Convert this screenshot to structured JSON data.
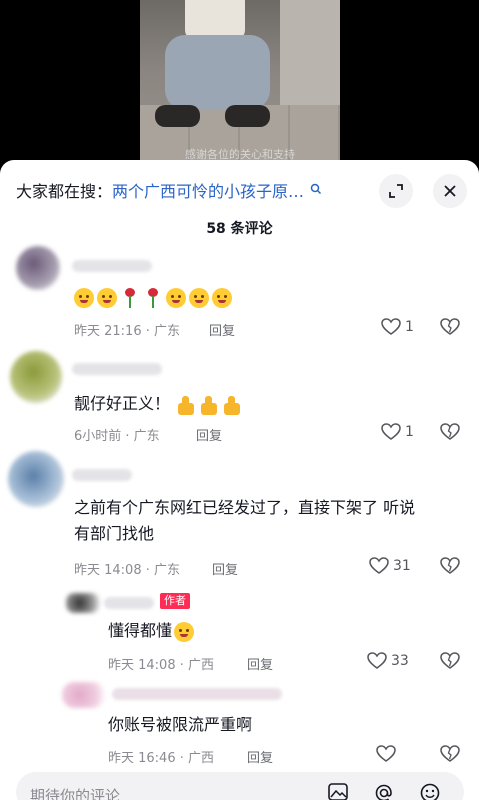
{
  "video": {
    "caption": "感谢各位的关心和支持"
  },
  "header": {
    "search_prefix": "大家都在搜：",
    "search_term": "两个广西可怜的小孩子原…"
  },
  "comment_count": "58 条评论",
  "comments": [
    {
      "text": "",
      "time": "昨天 21:16 · 广东",
      "reply": "回复",
      "likes": "1"
    },
    {
      "text": "靓仔好正义！",
      "time": "6小时前 · 广东",
      "reply": "回复",
      "likes": "1"
    },
    {
      "text_line1": "之前有个广东网红已经发过了，直接下架了 听说",
      "text_line2": "有部门找他",
      "time": "昨天 14:08 · 广东",
      "reply": "回复",
      "likes": "31"
    },
    {
      "badge": "作者",
      "text": "懂得都懂",
      "time": "昨天 14:08 · 广西",
      "reply": "回复",
      "likes": "33"
    },
    {
      "text": "你账号被限流严重啊",
      "time": "昨天 16:46 · 广西",
      "reply": "回复",
      "likes": ""
    }
  ],
  "input": {
    "placeholder": "期待你的评论"
  },
  "icons": [
    "search-icon",
    "expand-icon",
    "close-icon",
    "heart-icon",
    "broken-heart-icon",
    "image-icon",
    "at-icon",
    "emoji-icon"
  ],
  "colors": {
    "accent_red": "#fe2c55",
    "link_blue": "#2a64c7",
    "emoji_yellow": "#ffcc33"
  }
}
